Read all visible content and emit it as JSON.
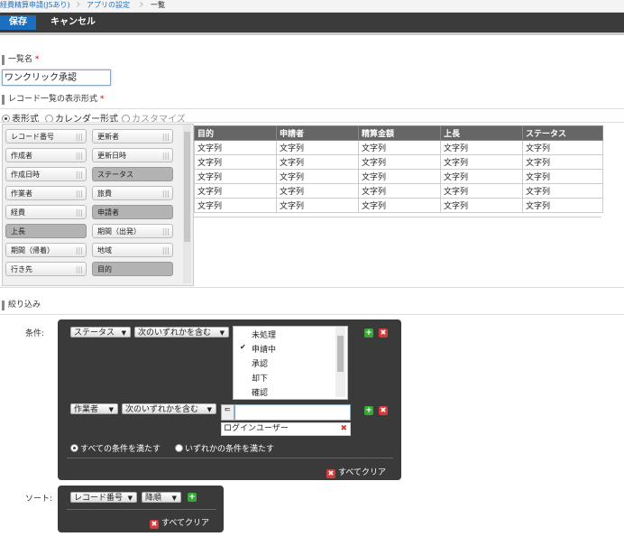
{
  "breadcrumb": {
    "app": "経費精算申請(JSあり)",
    "settings": "アプリの設定",
    "current": "一覧"
  },
  "toolbar": {
    "save": "保存",
    "cancel": "キャンセル"
  },
  "list_name": {
    "label": "一覧名",
    "required": "*",
    "value": "ワンクリック承認"
  },
  "display_format": {
    "label": "レコード一覧の表示形式",
    "required": "*",
    "options": [
      "表形式",
      "カレンダー形式",
      "カスタマイズ"
    ],
    "selected": "表形式"
  },
  "fields": [
    {
      "label": "レコード番号",
      "used": false
    },
    {
      "label": "更新者",
      "used": false
    },
    {
      "label": "作成者",
      "used": false
    },
    {
      "label": "更新日時",
      "used": false
    },
    {
      "label": "作成日時",
      "used": false
    },
    {
      "label": "ステータス",
      "used": true
    },
    {
      "label": "作業者",
      "used": false
    },
    {
      "label": "旅費",
      "used": false
    },
    {
      "label": "経費",
      "used": false
    },
    {
      "label": "申請者",
      "used": true
    },
    {
      "label": "上長",
      "used": true
    },
    {
      "label": "期間（出発）",
      "used": false
    },
    {
      "label": "期間（帰着）",
      "used": false
    },
    {
      "label": "地域",
      "used": false
    },
    {
      "label": "行き先",
      "used": false
    },
    {
      "label": "目的",
      "used": true
    }
  ],
  "preview": {
    "columns": [
      "目的",
      "申請者",
      "精算金額",
      "上長",
      "ステータス"
    ],
    "cell": "文字列",
    "row_count": 5
  },
  "filter": {
    "section": "絞り込み",
    "condition_label": "条件:",
    "cond1": {
      "field": "ステータス",
      "op": "次のいずれかを含む",
      "options": [
        "未処理",
        "申請中",
        "承認",
        "却下",
        "確認"
      ],
      "checked": "申請中"
    },
    "cond2": {
      "field": "作業者",
      "op": "次のいずれかを含む",
      "user": "ログインユーザー"
    },
    "match_all": "すべての条件を満たす",
    "match_any": "いずれかの条件を満たす",
    "clear": "すべてクリア"
  },
  "sort": {
    "label": "ソート:",
    "field": "レコード番号",
    "order": "降順",
    "clear": "すべてクリア"
  }
}
